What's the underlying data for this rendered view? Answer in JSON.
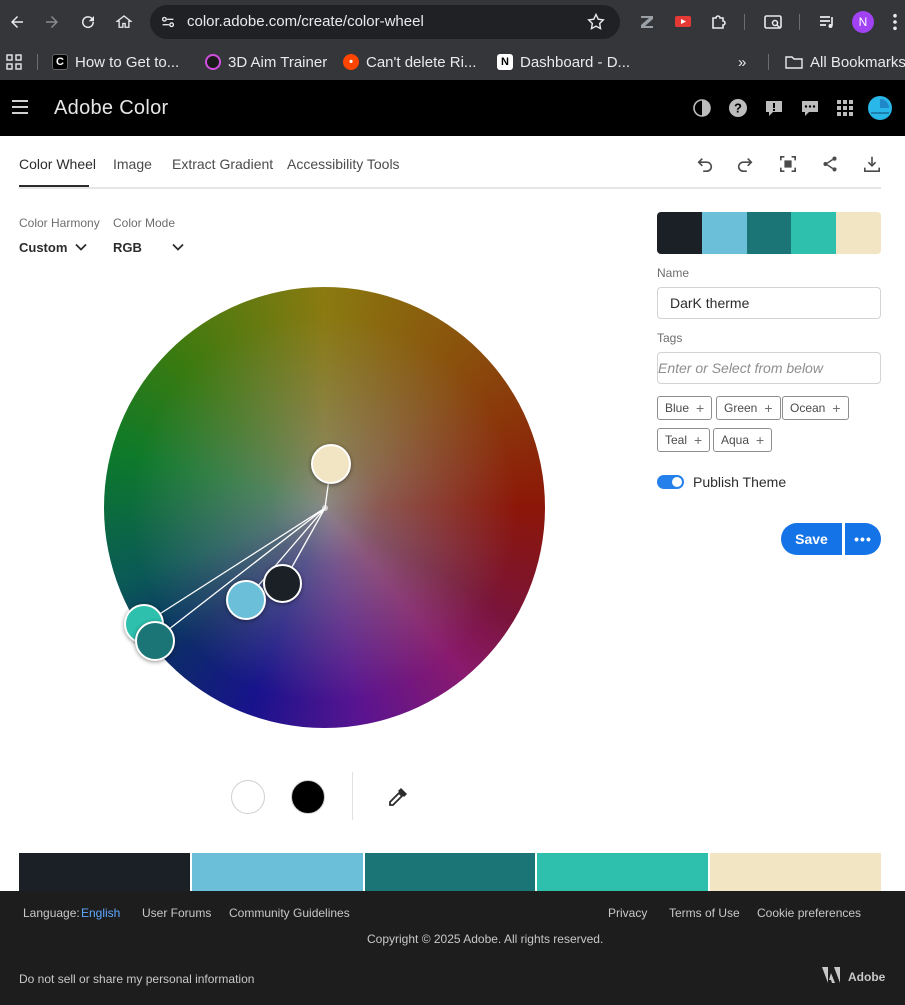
{
  "browser": {
    "url": "color.adobe.com/create/color-wheel",
    "profile_initial": "N",
    "bookmarks": [
      {
        "label": "How to Get to..."
      },
      {
        "label": "3D Aim Trainer"
      },
      {
        "label": "Can't delete Ri..."
      },
      {
        "label": "Dashboard - D..."
      }
    ],
    "more_bookmarks": "»",
    "all_bookmarks": "All Bookmarks"
  },
  "app": {
    "title": "Adobe Color"
  },
  "tabs": [
    {
      "label": "Color Wheel",
      "active": true
    },
    {
      "label": "Image",
      "active": false
    },
    {
      "label": "Extract Gradient",
      "active": false
    },
    {
      "label": "Accessibility Tools",
      "active": false
    }
  ],
  "controls": {
    "harmony_label": "Color Harmony",
    "harmony_value": "Custom",
    "mode_label": "Color Mode",
    "mode_value": "RGB"
  },
  "theme": {
    "colors": [
      "#1b2026",
      "#6bbfd9",
      "#1b7577",
      "#2ec0ad",
      "#f2e5c3"
    ],
    "name_label": "Name",
    "name_value": "DarK therme",
    "tags_label": "Tags",
    "tags_placeholder": "Enter or Select from below",
    "tags": [
      "Blue",
      "Green",
      "Ocean",
      "Teal",
      "Aqua"
    ],
    "publish_label": "Publish Theme",
    "publish_on": true,
    "save_label": "Save",
    "more_label": "•••"
  },
  "footer": {
    "language_label": "Language:",
    "language_value": "English",
    "user_forums": "User Forums",
    "community_guidelines": "Community Guidelines",
    "privacy": "Privacy",
    "terms": "Terms of Use",
    "cookies": "Cookie preferences",
    "copyright": "Copyright © 2025 Adobe. All rights reserved.",
    "do_not_sell": "Do not sell or share my personal information",
    "brand": "Adobe"
  },
  "colors": {
    "accent": "#1473e6",
    "header_bg": "#000000",
    "footer_bg": "#1d1d1d"
  }
}
